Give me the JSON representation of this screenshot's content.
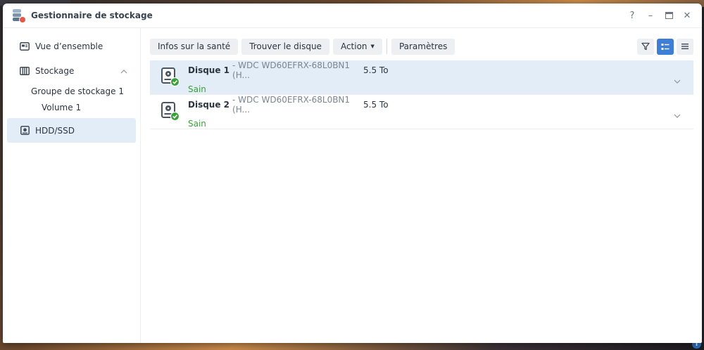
{
  "window": {
    "title": "Gestionnaire de stockage"
  },
  "window_controls": {
    "help": "?",
    "minimize": "–",
    "close": "✕"
  },
  "sidebar": {
    "overview": "Vue d’ensemble",
    "storage": "Stockage",
    "storage_pool": "Groupe de stockage 1",
    "volume": "Volume 1",
    "hdd": "HDD/SSD"
  },
  "toolbar": {
    "health_info": "Infos sur la santé",
    "find_disk": "Trouver le disque",
    "action": "Action",
    "settings": "Paramètres"
  },
  "disks": [
    {
      "name": "Disque 1",
      "model": "- WDC WD60EFRX-68L0BN1 (H...",
      "size": "5.5 To",
      "status": "Sain"
    },
    {
      "name": "Disque 2",
      "model": "- WDC WD60EFRX-68L0BN1 (H...",
      "size": "5.5 To",
      "status": "Sain"
    }
  ],
  "colors": {
    "accent": "#3c7fd4",
    "healthy": "#3aa13a",
    "selected_row": "#e3edf8"
  },
  "desktop": {
    "info_badge": "i"
  }
}
